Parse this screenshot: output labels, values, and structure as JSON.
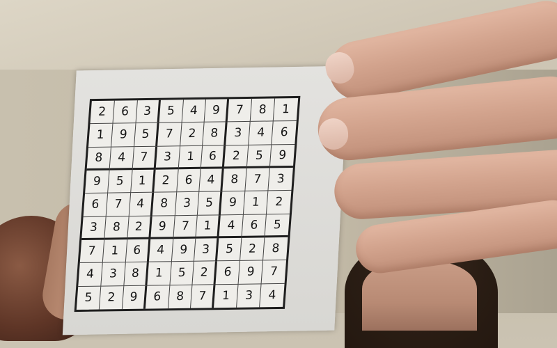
{
  "sudoku": {
    "rows": [
      [
        "2",
        "6",
        "3",
        "5",
        "4",
        "9",
        "7",
        "8",
        "1"
      ],
      [
        "1",
        "9",
        "5",
        "7",
        "2",
        "8",
        "3",
        "4",
        "6"
      ],
      [
        "8",
        "4",
        "7",
        "3",
        "1",
        "6",
        "2",
        "5",
        "9"
      ],
      [
        "9",
        "5",
        "1",
        "2",
        "6",
        "4",
        "8",
        "7",
        "3"
      ],
      [
        "6",
        "7",
        "4",
        "8",
        "3",
        "5",
        "9",
        "1",
        "2"
      ],
      [
        "3",
        "8",
        "2",
        "9",
        "7",
        "1",
        "4",
        "6",
        "5"
      ],
      [
        "7",
        "1",
        "6",
        "4",
        "9",
        "3",
        "5",
        "2",
        "8"
      ],
      [
        "4",
        "3",
        "8",
        "1",
        "5",
        "2",
        "6",
        "9",
        "7"
      ],
      [
        "5",
        "2",
        "9",
        "6",
        "8",
        "7",
        "1",
        "3",
        "4"
      ]
    ]
  },
  "colors": {
    "grid_line": "#1e1e1e",
    "paper": "#efeeea",
    "skin": "#d3a48e",
    "wall": "#c8c0ae"
  }
}
